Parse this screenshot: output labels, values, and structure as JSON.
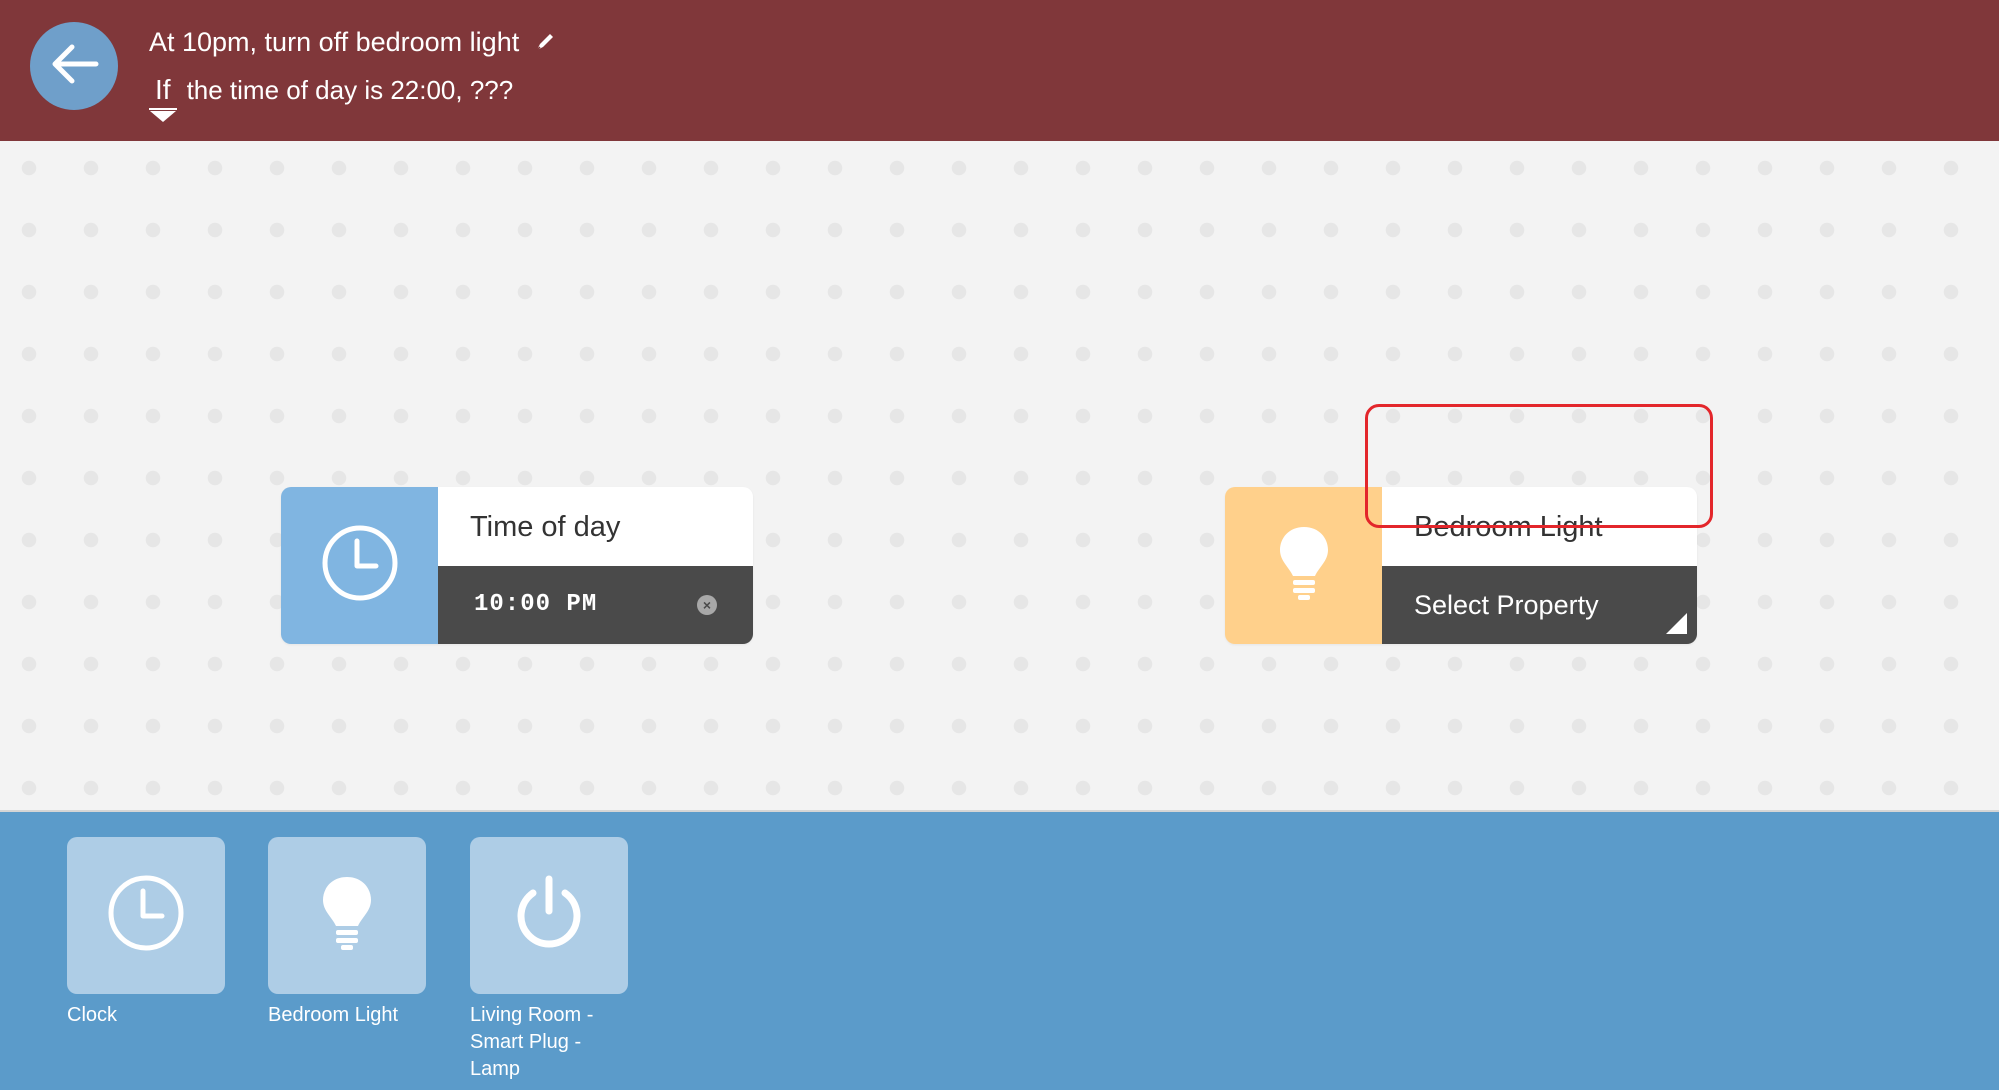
{
  "header": {
    "rule_title": "At 10pm, turn off bedroom light",
    "if_label": "If",
    "rule_text": "the time of day is 22:00, ???",
    "colors": {
      "background": "#80373a",
      "back_button": "#6f9fca"
    },
    "icons": {
      "back": "arrow-left-icon",
      "edit": "pencil-icon"
    }
  },
  "canvas": {
    "trigger_block": {
      "title": "Time of day",
      "time_value": "10:00 PM",
      "clear_glyph": "×",
      "icon": "clock-icon",
      "icon_color": "#80b5e1"
    },
    "action_block": {
      "title": "Bedroom Light",
      "select_label": "Select Property",
      "icon": "lightbulb-icon",
      "icon_color": "#ffd08b",
      "highlight_color": "#e3262b"
    }
  },
  "palette": {
    "background": "#5b9bca",
    "items": [
      {
        "label": "Clock",
        "icon": "clock-icon"
      },
      {
        "label": "Bedroom Light",
        "icon": "lightbulb-icon"
      },
      {
        "label": "Living Room - Smart Plug - Lamp",
        "icon": "power-icon"
      }
    ]
  }
}
